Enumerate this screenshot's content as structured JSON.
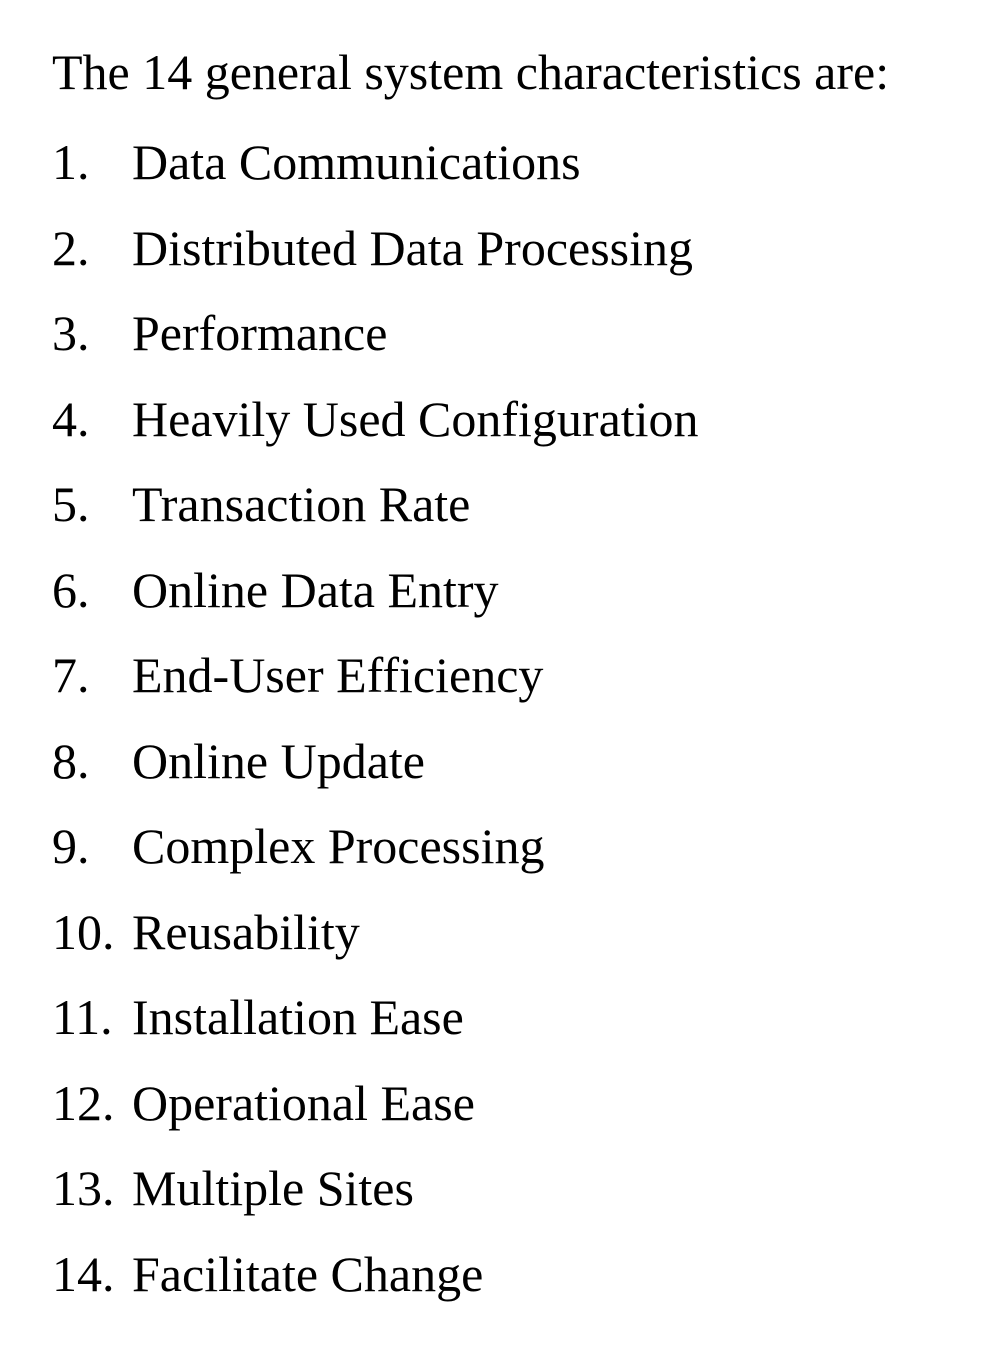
{
  "document": {
    "intro": "The 14 general system characteristics are:",
    "items": [
      {
        "number": "1.",
        "label": "Data Communications"
      },
      {
        "number": "2.",
        "label": "Distributed Data Processing"
      },
      {
        "number": "3.",
        "label": "Performance"
      },
      {
        "number": "4.",
        "label": "Heavily Used Configuration"
      },
      {
        "number": "5.",
        "label": "Transaction Rate"
      },
      {
        "number": "6.",
        "label": "Online Data Entry"
      },
      {
        "number": "7.",
        "label": "End-User Efficiency"
      },
      {
        "number": "8.",
        "label": "Online Update"
      },
      {
        "number": "9.",
        "label": "Complex Processing"
      },
      {
        "number": "10.",
        "label": "Reusability"
      },
      {
        "number": "11.",
        "label": "Installation Ease"
      },
      {
        "number": "12.",
        "label": "Operational Ease"
      },
      {
        "number": "13.",
        "label": "Multiple Sites"
      },
      {
        "number": "14.",
        "label": "Facilitate Change"
      }
    ]
  }
}
